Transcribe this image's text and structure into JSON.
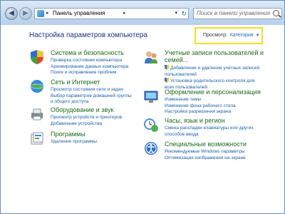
{
  "address": {
    "path": "Панель управления",
    "search_placeholder": "Поиск в панели управления"
  },
  "heading": "Настройка параметров компьютера",
  "view_by": {
    "label": "Просмотр:",
    "value": "Категория"
  },
  "categories": [
    {
      "title": "Система и безопасность",
      "icon": "system-security-icon",
      "links": [
        "Проверка состояния компьютера",
        "Архивирование данных компьютера",
        "Поиск и исправление проблем"
      ]
    },
    {
      "title": "Сеть и Интернет",
      "icon": "network-icon",
      "links": [
        "Просмотр состояния сети и задач",
        "Выбор параметров домашней группы",
        "и общего доступа"
      ]
    },
    {
      "title": "Оборудование и звук",
      "icon": "hardware-sound-icon",
      "links": [
        "Просмотр устройств и принтеров",
        "Добавление устройства"
      ]
    },
    {
      "title": "Программы",
      "icon": "programs-icon",
      "links": [
        "Удаление программы"
      ]
    },
    {
      "title": "Учетные записи пользователей и",
      "title2": "семей...",
      "icon": "user-accounts-icon",
      "links": [
        "Добавление и удаление учетных записей",
        "пользователей",
        "Установка родительского контроля для",
        "всех пользователей"
      ]
    },
    {
      "title": "Оформление и персонализация",
      "icon": "appearance-icon",
      "links": [
        "Изменение темы",
        "Изменение фона рабочего стола",
        "Настройка разрешения экрана"
      ]
    },
    {
      "title": "Часы, язык и регион",
      "icon": "clock-language-icon",
      "links": [
        "Смена раскладки клавиатуры или других",
        "способов ввода"
      ]
    },
    {
      "title": "Специальные возможности",
      "icon": "accessibility-icon",
      "links": [
        "Рекомендуемые Windows параметры",
        "Оптимизация изображения на экране"
      ]
    }
  ]
}
